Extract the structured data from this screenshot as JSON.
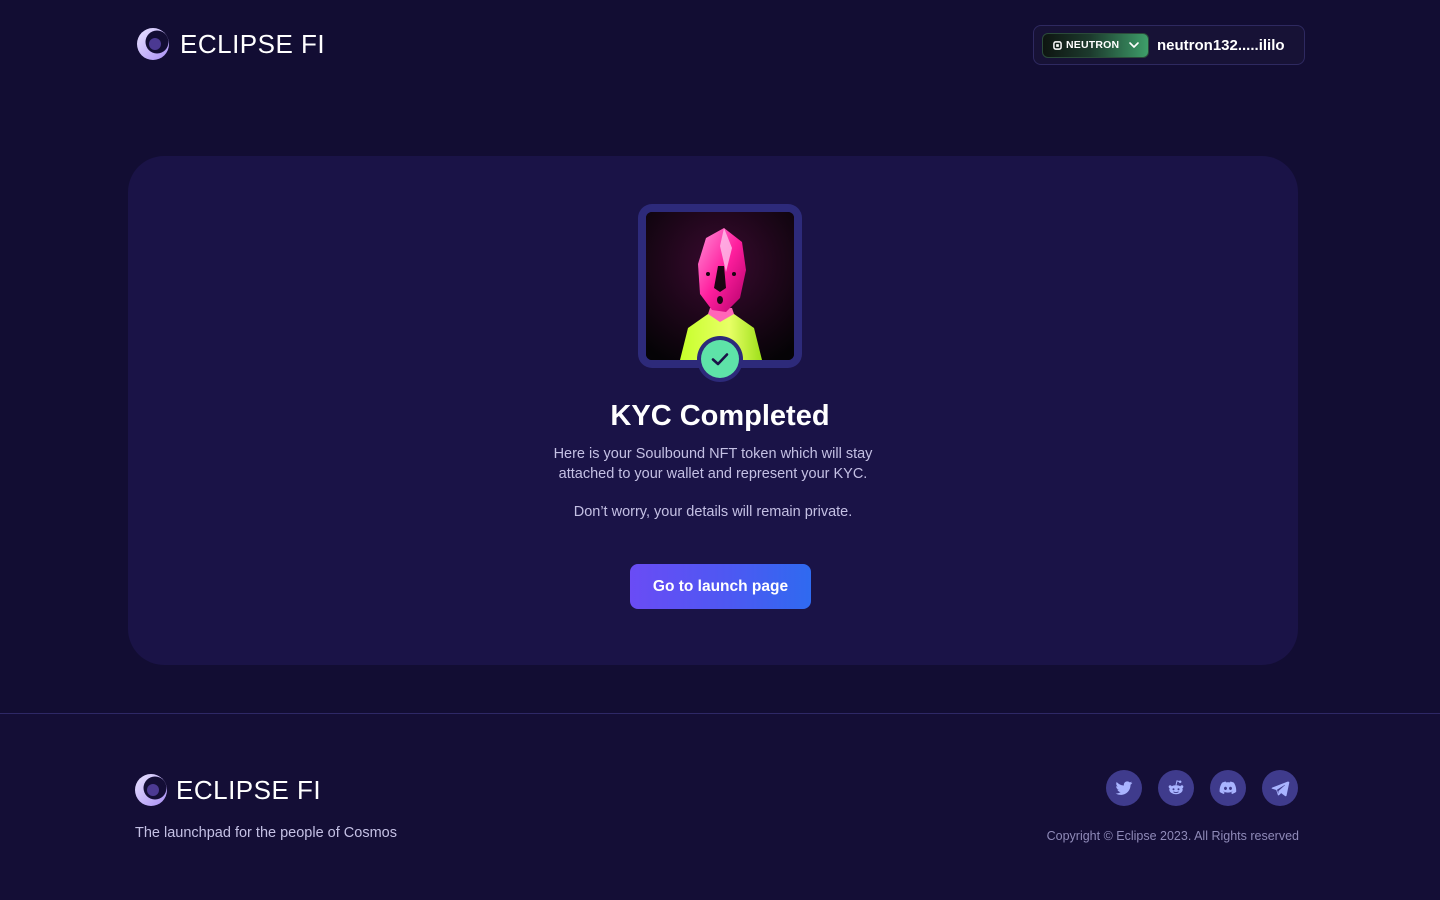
{
  "header": {
    "brand": "ECLIPSE FI",
    "wallet": {
      "chain": "NEUTRON",
      "address": "neutron132.....ililo"
    }
  },
  "card": {
    "title": "KYC Completed",
    "description_line1": "Here is your Soulbound NFT token which will stay",
    "description_line2": "attached to your wallet and represent your KYC.",
    "note": "Don’t worry, your details will remain private.",
    "button_label": "Go to launch page"
  },
  "footer": {
    "brand": "ECLIPSE FI",
    "tagline": "The launchpad for the people of Cosmos",
    "copyright": "Copyright © Eclipse 2023. All Rights reserved",
    "socials": [
      "twitter-icon",
      "reddit-icon",
      "discord-icon",
      "telegram-icon"
    ]
  },
  "colors": {
    "background": "#120d33",
    "card": "#1a1347",
    "accent_start": "#6a4cf5",
    "accent_end": "#2f6af0",
    "success": "#5ee3a8",
    "muted_text": "#c4c0e4"
  }
}
